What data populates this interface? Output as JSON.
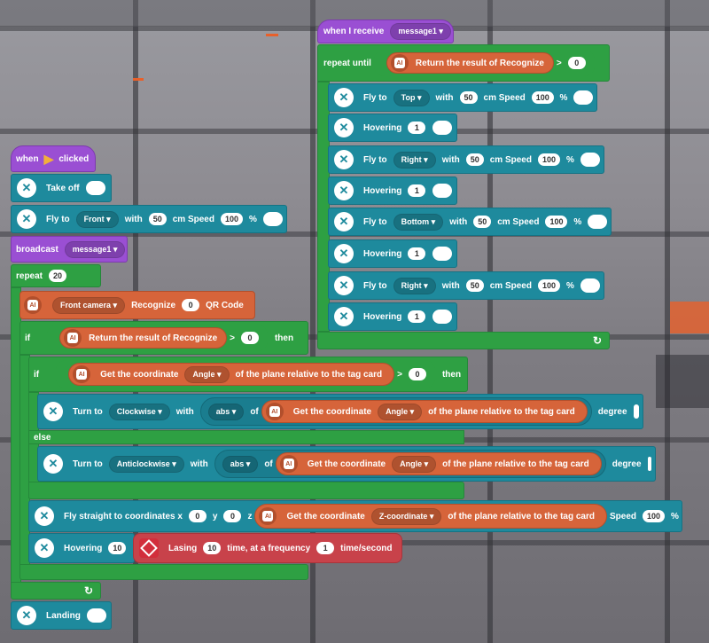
{
  "colors": {
    "motion": "#1e8a9d",
    "control": "#2ea043",
    "event": "#9a4fd3",
    "ai": "#d6643a",
    "laser": "#d22e3c"
  },
  "event_script": {
    "hat_when": "when",
    "hat_clicked": "clicked",
    "takeoff": "Take off",
    "fly_to": "Fly to",
    "dir_front": "Front",
    "with": "with",
    "v50": "50",
    "cm_speed": "cm Speed",
    "v100": "100",
    "pct": "%",
    "broadcast": "broadcast",
    "msg1": "message1",
    "repeat": "repeat",
    "repeat_n": "20",
    "front_camera": "Front camera",
    "recognize": "Recognize",
    "v0": "0",
    "qr": "QR Code",
    "if": "if",
    "then": "then",
    "else": "else",
    "ret_result": "Return the result of Recognize",
    "gt": ">",
    "get_coord": "Get the coordinate",
    "angle": "Angle",
    "plane_rel": "of the plane relative to the tag card",
    "turn_to": "Turn to",
    "clockwise": "Clockwise",
    "anticlockwise": "Anticlockwise",
    "abs": "abs",
    "of": "of",
    "degree": "degree",
    "fly_straight": "Fly straight to coordinates x",
    "y": "y",
    "z": "z",
    "zcoord": "Z-coordinate",
    "speed": "Speed",
    "hovering": "Hovering",
    "v10": "10",
    "lasing": "Lasing",
    "time_freq": "time, at a frequency",
    "v1": "1",
    "time_sec": "time/second",
    "landing": "Landing"
  },
  "receive_script": {
    "hat": "when I receive",
    "msg1": "message1",
    "repeat_until": "repeat until",
    "ret_result": "Return the result of Recognize",
    "gt": ">",
    "v0": "0",
    "fly_to": "Fly to",
    "with": "with",
    "v50": "50",
    "cm_speed": "cm Speed",
    "v100": "100",
    "pct": "%",
    "dir_top": "Top",
    "dir_right": "Right",
    "dir_bottom": "Bottom",
    "hovering": "Hovering",
    "v1": "1"
  }
}
